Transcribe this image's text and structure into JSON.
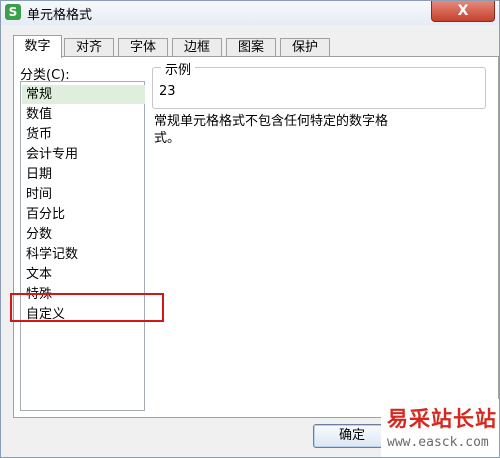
{
  "window": {
    "title": "单元格格式",
    "close_label": "X",
    "app_icon_label": "S"
  },
  "tabs": [
    {
      "label": "数字",
      "active": true
    },
    {
      "label": "对齐"
    },
    {
      "label": "字体"
    },
    {
      "label": "边框"
    },
    {
      "label": "图案"
    },
    {
      "label": "保护"
    }
  ],
  "category": {
    "label": "分类(C):",
    "items": [
      "常规",
      "数值",
      "货币",
      "会计专用",
      "日期",
      "时间",
      "百分比",
      "分数",
      "科学记数",
      "文本",
      "特殊",
      "自定义"
    ],
    "selected": "常规",
    "highlighted": "自定义"
  },
  "sample": {
    "legend": "示例",
    "value": "23"
  },
  "description": "常规单元格格式不包含任何特定的数字格式。",
  "buttons": {
    "ok": "确定"
  },
  "watermark": {
    "top": "易采站长站",
    "bottom": "www.easck.com"
  },
  "colors": {
    "selection": "#dfeedd",
    "highlight_border": "#d01818",
    "watermark": "#d6281e"
  }
}
